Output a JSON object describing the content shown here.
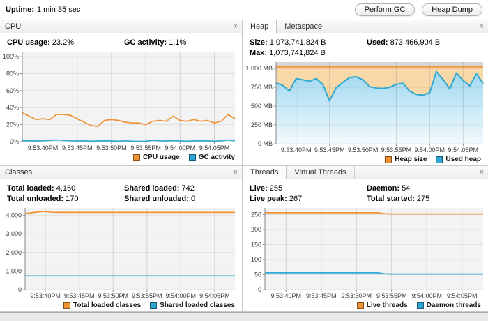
{
  "icons": {
    "close": "×"
  },
  "toolbar": {
    "uptime_label": "Uptime:",
    "uptime_value": "1 min 35 sec",
    "perform_gc_label": "Perform GC",
    "heap_dump_label": "Heap Dump"
  },
  "panels": {
    "cpu": {
      "title": "CPU",
      "stats": [
        {
          "label": "CPU usage:",
          "value": "23.2%"
        },
        {
          "label": "GC activity:",
          "value": "1.1%"
        }
      ],
      "legend": [
        {
          "label": "CPU usage"
        },
        {
          "label": "GC activity"
        }
      ]
    },
    "heap": {
      "tabs": [
        "Heap",
        "Metaspace"
      ],
      "stats": [
        {
          "label": "Size:",
          "value": "1,073,741,824 B"
        },
        {
          "label": "Used:",
          "value": "873,466,904 B"
        },
        {
          "label": "Max:",
          "value": "1,073,741,824 B"
        },
        {
          "label": "",
          "value": ""
        }
      ],
      "legend": [
        {
          "label": "Heap size"
        },
        {
          "label": "Used heap"
        }
      ]
    },
    "classes": {
      "title": "Classes",
      "stats": [
        {
          "label": "Total loaded:",
          "value": "4,160"
        },
        {
          "label": "Shared loaded:",
          "value": "742"
        },
        {
          "label": "Total unloaded:",
          "value": "170"
        },
        {
          "label": "Shared unloaded:",
          "value": "0"
        }
      ],
      "legend": [
        {
          "label": "Total loaded classes"
        },
        {
          "label": "Shared loaded classes"
        }
      ]
    },
    "threads": {
      "tabs": [
        "Threads",
        "Virtual Threads"
      ],
      "stats": [
        {
          "label": "Live:",
          "value": "255"
        },
        {
          "label": "Daemon:",
          "value": "54"
        },
        {
          "label": "Live peak:",
          "value": "267"
        },
        {
          "label": "Total started:",
          "value": "275"
        }
      ],
      "legend": [
        {
          "label": "Live threads"
        },
        {
          "label": "Daemon threads"
        }
      ]
    }
  },
  "chart_data": [
    {
      "id": "cpu",
      "type": "line",
      "title": "CPU",
      "ylabel": "percent",
      "ylim": [
        0,
        105
      ],
      "bg": "#f3f3f3",
      "grid": true,
      "legend_position": "bottom-right",
      "yticks": [
        {
          "v": 0,
          "label": "0%"
        },
        {
          "v": 20,
          "label": "20%"
        },
        {
          "v": 40,
          "label": "40%"
        },
        {
          "v": 60,
          "label": "60%"
        },
        {
          "v": 80,
          "label": "80%"
        },
        {
          "v": 100,
          "label": "100%"
        }
      ],
      "xticks": [
        {
          "f": 0.0968,
          "label": "9:53:40PM"
        },
        {
          "f": 0.2581,
          "label": "9:53:45PM"
        },
        {
          "f": 0.4194,
          "label": "9:53:50PM"
        },
        {
          "f": 0.5806,
          "label": "9:53:55PM"
        },
        {
          "f": 0.7419,
          "label": "9:54:00PM"
        },
        {
          "f": 0.9032,
          "label": "9:54:05PM"
        }
      ],
      "series": [
        {
          "name": "CPU usage",
          "color": "#ee9234",
          "values": [
            34,
            30,
            26,
            27,
            26,
            32,
            32,
            31,
            27,
            23,
            19,
            18,
            25,
            26,
            25,
            23,
            22,
            22,
            20,
            24,
            25,
            24,
            30,
            25,
            24,
            26,
            24,
            25,
            22,
            24,
            32,
            27
          ]
        },
        {
          "name": "GC activity",
          "color": "#2fa7d3",
          "values": [
            1,
            1,
            0.8,
            1,
            1.5,
            2,
            1.5,
            1,
            0.8,
            1,
            0.5,
            0.8,
            1,
            0.8,
            0.5,
            1,
            0.5,
            0.3,
            0.5,
            1.5,
            1,
            0.8,
            1.2,
            0.8,
            0.5,
            1,
            0.8,
            1,
            0.5,
            1,
            2,
            1.1
          ]
        }
      ]
    },
    {
      "id": "heap",
      "type": "area",
      "title": "Heap",
      "ylabel": "MB",
      "ylim": [
        0,
        1085
      ],
      "bg": "#d7d7d7",
      "grid": true,
      "legend_position": "bottom-right",
      "yticks": [
        {
          "v": 0,
          "label": "0 MB"
        },
        {
          "v": 250,
          "label": "250 MB"
        },
        {
          "v": 500,
          "label": "500 MB"
        },
        {
          "v": 750,
          "label": "750 MB"
        },
        {
          "v": 1000,
          "label": "1,000 MB"
        }
      ],
      "xticks": [
        {
          "f": 0.0968,
          "label": "9:53:40PM"
        },
        {
          "f": 0.2581,
          "label": "9:53:45PM"
        },
        {
          "f": 0.4194,
          "label": "9:53:50PM"
        },
        {
          "f": 0.5806,
          "label": "9:53:55PM"
        },
        {
          "f": 0.7419,
          "label": "9:54:00PM"
        },
        {
          "f": 0.9032,
          "label": "9:54:05PM"
        }
      ],
      "series": [
        {
          "name": "Heap size",
          "color": "#ee9234",
          "fill": "#f7d8a9",
          "stroke_width": 2,
          "values": [
            1024,
            1024,
            1024,
            1024,
            1024,
            1024,
            1024,
            1024,
            1024,
            1024,
            1024,
            1024,
            1024,
            1024,
            1024,
            1024,
            1024,
            1024,
            1024,
            1024,
            1024,
            1024,
            1024,
            1024,
            1024,
            1024,
            1024,
            1024,
            1024,
            1024,
            1024,
            1024
          ]
        },
        {
          "name": "Used heap",
          "color": "#2fa7d3",
          "fill": "gradient",
          "fill_from": "#9fd8ef",
          "fill_to": "#f2fafd",
          "stroke_width": 2,
          "values": [
            810,
            775,
            700,
            865,
            850,
            830,
            865,
            790,
            570,
            745,
            815,
            880,
            890,
            850,
            760,
            740,
            735,
            750,
            790,
            805,
            700,
            655,
            645,
            680,
            960,
            855,
            730,
            940,
            840,
            770,
            930,
            800
          ]
        }
      ]
    },
    {
      "id": "classes",
      "type": "line",
      "title": "Classes",
      "ylabel": "classes",
      "ylim": [
        0,
        4400
      ],
      "bg": "#f3f3f3",
      "grid": true,
      "legend_position": "bottom-right",
      "yticks": [
        {
          "v": 0,
          "label": "0"
        },
        {
          "v": 1000,
          "label": "1,000"
        },
        {
          "v": 2000,
          "label": "2,000"
        },
        {
          "v": 3000,
          "label": "3,000"
        },
        {
          "v": 4000,
          "label": "4,000"
        }
      ],
      "xticks": [
        {
          "f": 0.0968,
          "label": "9:53:40PM"
        },
        {
          "f": 0.2581,
          "label": "9:53:45PM"
        },
        {
          "f": 0.4194,
          "label": "9:53:50PM"
        },
        {
          "f": 0.5806,
          "label": "9:53:55PM"
        },
        {
          "f": 0.7419,
          "label": "9:54:00PM"
        },
        {
          "f": 0.9032,
          "label": "9:54:05PM"
        }
      ],
      "series": [
        {
          "name": "Total loaded classes",
          "color": "#ee9234",
          "values": [
            4100,
            4140,
            4190,
            4205,
            4165,
            4160,
            4160,
            4160,
            4160,
            4160,
            4160,
            4160,
            4160,
            4160,
            4160,
            4160,
            4160,
            4160,
            4160,
            4160,
            4160,
            4160,
            4160,
            4160,
            4160,
            4160,
            4160,
            4160,
            4160,
            4160,
            4160,
            4160
          ]
        },
        {
          "name": "Shared loaded classes",
          "color": "#2fa7d3",
          "values": [
            742,
            742,
            742,
            742,
            742,
            742,
            742,
            742,
            742,
            742,
            742,
            742,
            742,
            742,
            742,
            742,
            742,
            742,
            742,
            742,
            742,
            742,
            742,
            742,
            742,
            742,
            742,
            742,
            742,
            742,
            742,
            742
          ]
        }
      ]
    },
    {
      "id": "threads",
      "type": "line",
      "title": "Threads",
      "ylabel": "threads",
      "ylim": [
        0,
        272
      ],
      "bg": "#f3f3f3",
      "grid": true,
      "legend_position": "bottom-right",
      "yticks": [
        {
          "v": 0,
          "label": "0"
        },
        {
          "v": 50,
          "label": "50"
        },
        {
          "v": 100,
          "label": "100"
        },
        {
          "v": 150,
          "label": "150"
        },
        {
          "v": 200,
          "label": "200"
        },
        {
          "v": 250,
          "label": "250"
        }
      ],
      "xticks": [
        {
          "f": 0.0968,
          "label": "9:53:40PM"
        },
        {
          "f": 0.2581,
          "label": "9:53:45PM"
        },
        {
          "f": 0.4194,
          "label": "9:53:50PM"
        },
        {
          "f": 0.5806,
          "label": "9:53:55PM"
        },
        {
          "f": 0.7419,
          "label": "9:54:00PM"
        },
        {
          "f": 0.9032,
          "label": "9:54:05PM"
        }
      ],
      "series": [
        {
          "name": "Live threads",
          "color": "#ee9234",
          "values": [
            256,
            256,
            256,
            256,
            256,
            256,
            256,
            256,
            256,
            256,
            256,
            256,
            256,
            256,
            256,
            256,
            256,
            253,
            252,
            252,
            252,
            252,
            252,
            252,
            252,
            252,
            252,
            252,
            252,
            252,
            252,
            252
          ]
        },
        {
          "name": "Daemon threads",
          "color": "#2fa7d3",
          "values": [
            56,
            56,
            56,
            56,
            56,
            56,
            56,
            56,
            56,
            56,
            56,
            56,
            56,
            56,
            56,
            56,
            56,
            53,
            52,
            52,
            52,
            52,
            52,
            52,
            52,
            52,
            52,
            52,
            52,
            52,
            52,
            52
          ]
        }
      ]
    }
  ]
}
